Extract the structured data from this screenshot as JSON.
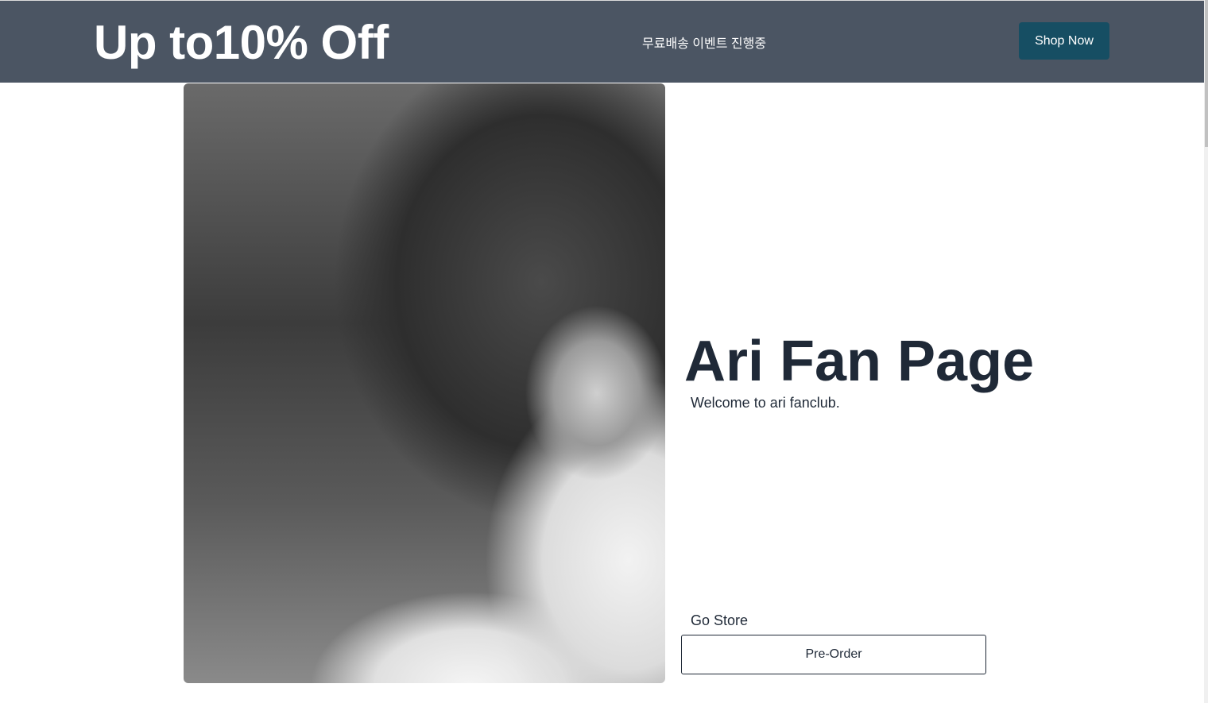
{
  "banner": {
    "promo_text": "Up to10% Off",
    "event_text": "무료배송 이벤트 진행중",
    "shop_button": "Shop Now",
    "background_color": "#4b5563",
    "button_color": "#164e63"
  },
  "hero": {
    "image_icon": "photo-image",
    "title": "Ari Fan Page",
    "subtitle": "Welcome to ari fanclub.",
    "store_label": "Go Store",
    "preorder_button": "Pre-Order"
  }
}
